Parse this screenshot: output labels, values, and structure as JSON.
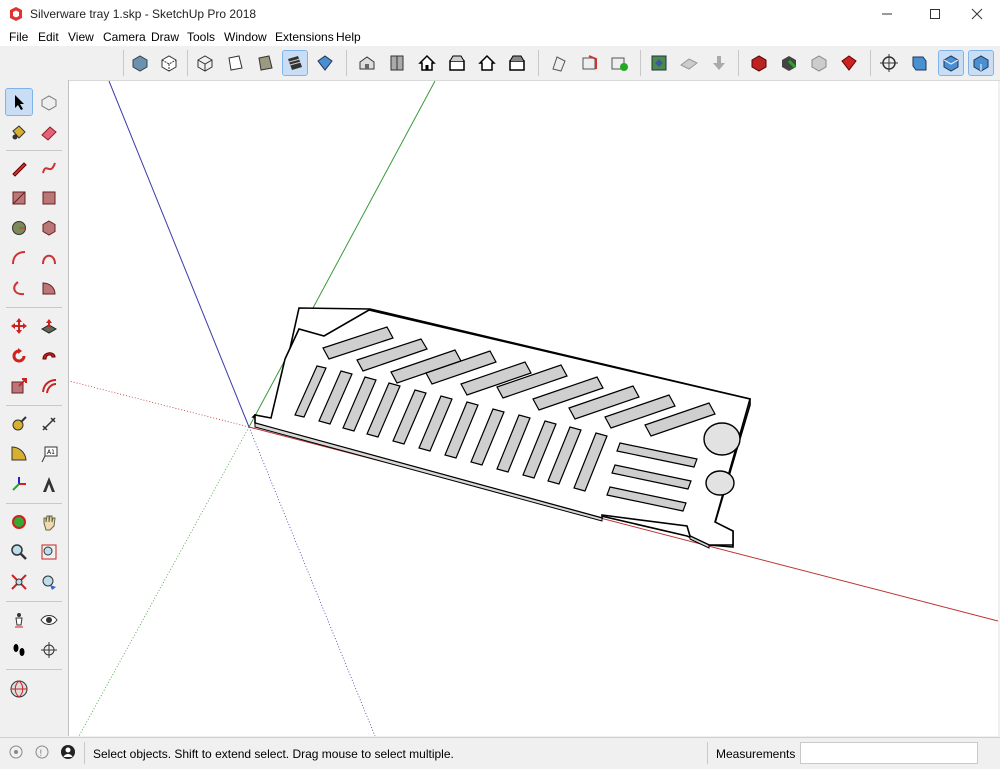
{
  "window": {
    "title": "Silverware tray 1.skp - SketchUp Pro 2018"
  },
  "menu": [
    "File",
    "Edit",
    "View",
    "Camera",
    "Draw",
    "Tools",
    "Window",
    "Extensions",
    "Help"
  ],
  "status": {
    "hint": "Select objects. Shift to extend select. Drag mouse to select multiple.",
    "measurements_label": "Measurements",
    "measurements_value": ""
  },
  "colors": {
    "axis_red": "#cc2222",
    "axis_green": "#2a9d2a",
    "axis_blue": "#2a2acc",
    "accent": "#c9def5"
  },
  "toolbar_icons": [
    "xray-icon",
    "back-edges-icon",
    "wireframe-icon",
    "hidden-line-icon",
    "shaded-icon",
    "shaded-textures-icon",
    "monochrome-icon",
    "iso-view-icon",
    "top-view-icon",
    "front-view-icon",
    "right-view-icon",
    "back-view-icon",
    "left-view-icon",
    "section-plane-icon",
    "display-section-planes-icon",
    "display-section-cuts-icon",
    "add-location-icon",
    "toggle-terrain-icon",
    "preview-icon",
    "3d-warehouse-icon",
    "extension-warehouse-icon",
    "share-model-icon",
    "ruby-icon",
    "orbit-icon",
    "standard-view-icon",
    "perspective-icon",
    "camera-icon"
  ],
  "left_tools": [
    "select-tool",
    "component-tool",
    "paint-bucket-tool",
    "eraser-tool",
    "line-tool",
    "freehand-tool",
    "rectangle-tool",
    "rotated-rectangle-tool",
    "circle-tool",
    "polygon-tool",
    "arc-tool",
    "two-point-arc-tool",
    "three-point-arc-tool",
    "pie-tool",
    "move-tool",
    "push-pull-tool",
    "rotate-tool",
    "follow-me-tool",
    "scale-tool",
    "offset-tool",
    "tape-measure-tool",
    "dimension-tool",
    "protractor-tool",
    "text-tool",
    "axes-tool",
    "3d-text-tool",
    "orbit-tool",
    "pan-tool",
    "zoom-tool",
    "zoom-window-tool",
    "zoom-extents-tool",
    "previous-view-tool",
    "position-camera-tool",
    "look-around-tool",
    "walk-tool",
    "section-plane-tool",
    "geo-location-tool"
  ]
}
